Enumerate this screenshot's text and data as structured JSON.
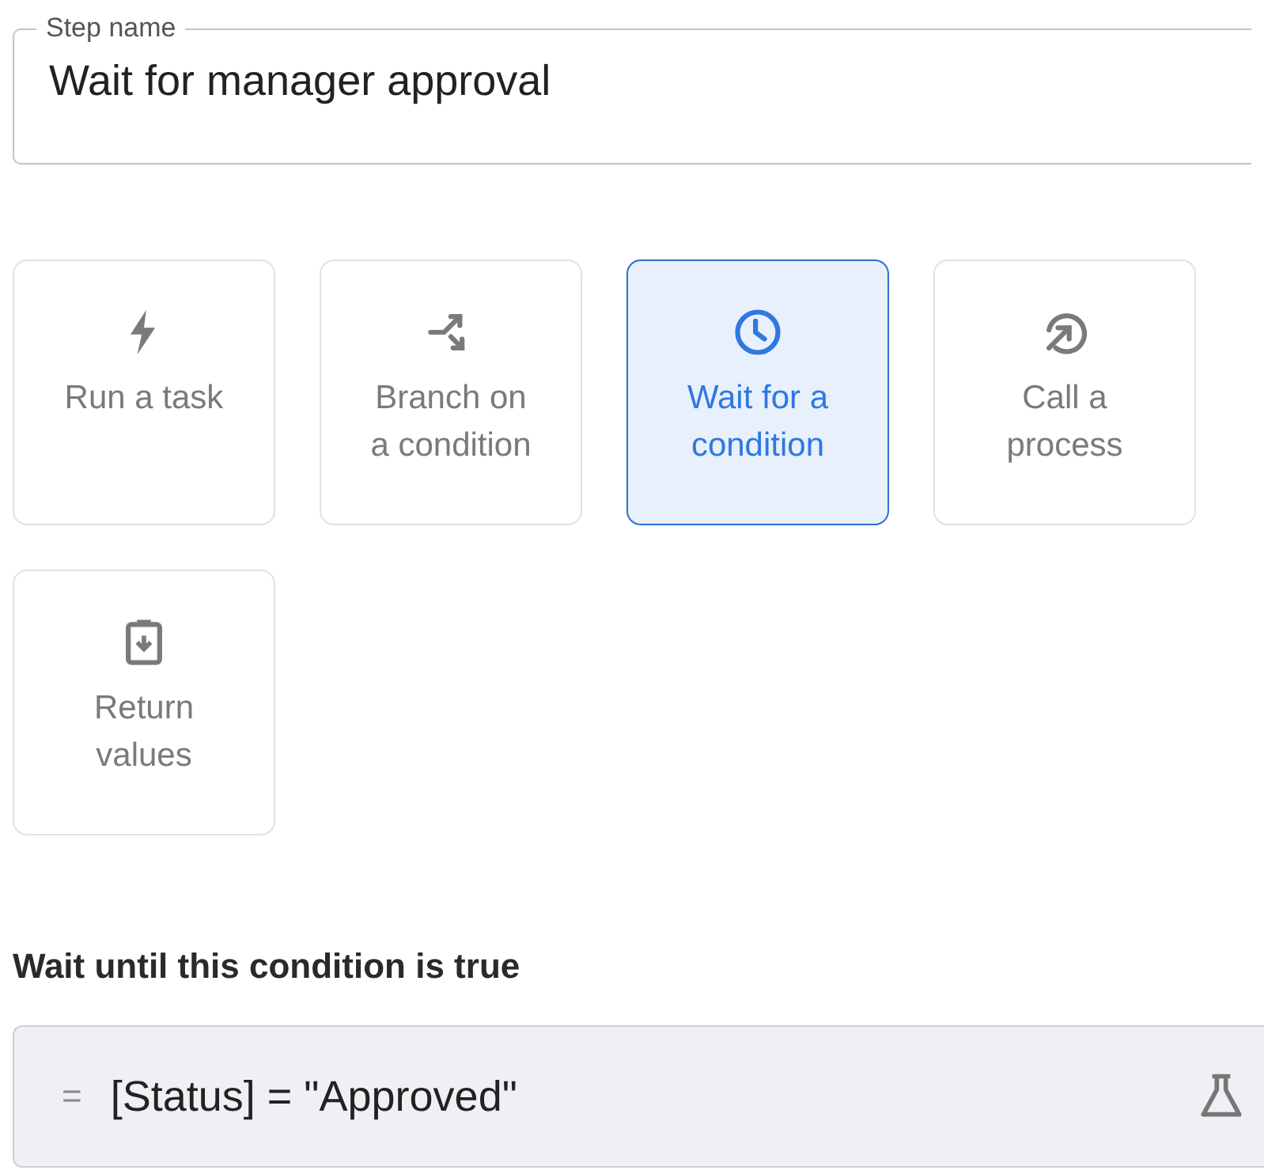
{
  "step_name": {
    "label": "Step name",
    "value": "Wait for manager approval"
  },
  "step_types": [
    {
      "kind": "task",
      "label_lines": [
        "Run a task"
      ],
      "selected": false
    },
    {
      "kind": "branch",
      "label_lines": [
        "Branch on",
        "a condition"
      ],
      "selected": false
    },
    {
      "kind": "wait",
      "label_lines": [
        "Wait for a",
        "condition"
      ],
      "selected": true
    },
    {
      "kind": "call",
      "label_lines": [
        "Call a",
        "process"
      ],
      "selected": false
    },
    {
      "kind": "return",
      "label_lines": [
        "Return",
        "values"
      ],
      "selected": false
    }
  ],
  "condition": {
    "heading": "Wait until this condition is true",
    "prefix": "=",
    "expression": "[Status] = \"Approved\""
  }
}
